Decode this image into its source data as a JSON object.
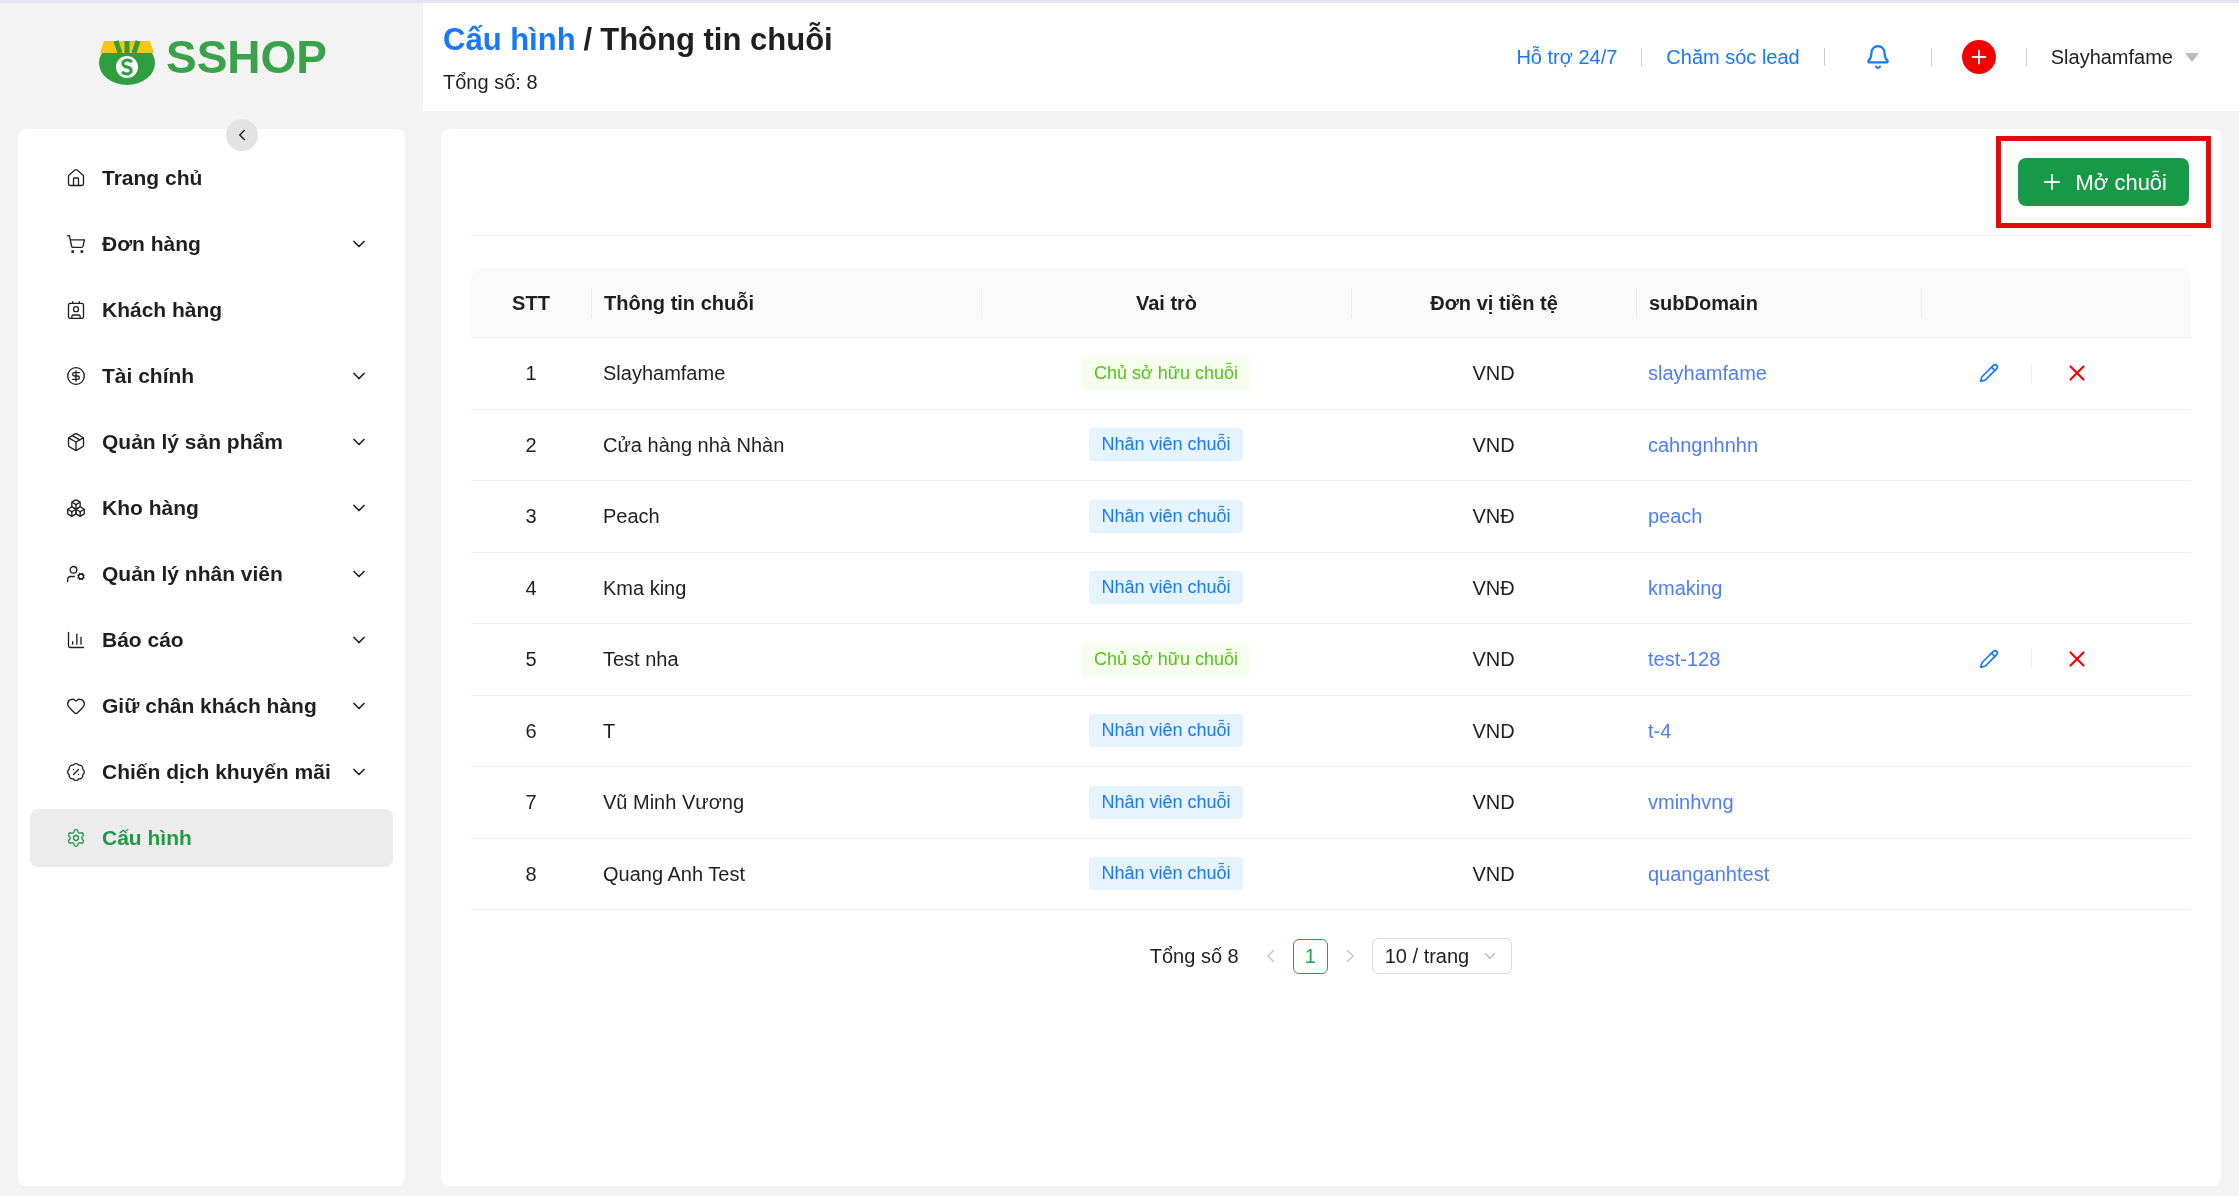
{
  "logo": {
    "text": "SSHOP"
  },
  "breadcrumb": {
    "parent": "Cấu hình",
    "separator": "/",
    "current": "Thông tin chuỗi"
  },
  "total": "Tổng số: 8",
  "header_links": [
    "Hỗ trợ 24/7",
    "Chăm sóc lead"
  ],
  "user": {
    "name": "Slayhamfame"
  },
  "sidebar": {
    "items": [
      {
        "label": "Trang chủ",
        "expandable": false,
        "selected": false
      },
      {
        "label": "Đơn hàng",
        "expandable": true,
        "selected": false
      },
      {
        "label": "Khách hàng",
        "expandable": false,
        "selected": false
      },
      {
        "label": "Tài chính",
        "expandable": true,
        "selected": false
      },
      {
        "label": "Quản lý sản phẩm",
        "expandable": true,
        "selected": false
      },
      {
        "label": "Kho hàng",
        "expandable": true,
        "selected": false
      },
      {
        "label": "Quản lý nhân viên",
        "expandable": true,
        "selected": false
      },
      {
        "label": "Báo cáo",
        "expandable": true,
        "selected": false
      },
      {
        "label": "Giữ chân khách hàng",
        "expandable": true,
        "selected": false
      },
      {
        "label": "Chiến dịch khuyến mãi",
        "expandable": true,
        "selected": false
      },
      {
        "label": "Cấu hình",
        "expandable": false,
        "selected": true
      }
    ]
  },
  "create_button": {
    "label": "Mở chuỗi",
    "highlighted": true
  },
  "table": {
    "columns": [
      "STT",
      "Thông tin chuỗi",
      "Vai trò",
      "Đơn vị tiền tệ",
      "subDomain"
    ],
    "rows": [
      {
        "stt": "1",
        "name": "Slayhamfame",
        "role": "Chủ sở hữu chuỗi",
        "kind": "owner",
        "currency": "VND",
        "subdomain": "slayhamfame",
        "editable": true
      },
      {
        "stt": "2",
        "name": "Cửa hàng nhà Nhàn",
        "role": "Nhân viên chuỗi",
        "kind": "staff",
        "currency": "VND",
        "subdomain": "cahngnhnhn",
        "editable": false
      },
      {
        "stt": "3",
        "name": "Peach",
        "role": "Nhân viên chuỗi",
        "kind": "staff",
        "currency": "VNĐ",
        "subdomain": "peach",
        "editable": false
      },
      {
        "stt": "4",
        "name": "Kma king",
        "role": "Nhân viên chuỗi",
        "kind": "staff",
        "currency": "VNĐ",
        "subdomain": "kmaking",
        "editable": false
      },
      {
        "stt": "5",
        "name": "Test nha",
        "role": "Chủ sở hữu chuỗi",
        "kind": "owner",
        "currency": "VND",
        "subdomain": "test-128",
        "editable": true
      },
      {
        "stt": "6",
        "name": "T",
        "role": "Nhân viên chuỗi",
        "kind": "staff",
        "currency": "VND",
        "subdomain": "t-4",
        "editable": false
      },
      {
        "stt": "7",
        "name": "Vũ Minh Vương",
        "role": "Nhân viên chuỗi",
        "kind": "staff",
        "currency": "VND",
        "subdomain": "vminhvng",
        "editable": false
      },
      {
        "stt": "8",
        "name": "Quang Anh Test",
        "role": "Nhân viên chuỗi",
        "kind": "staff",
        "currency": "VND",
        "subdomain": "quanganhtest",
        "editable": false
      }
    ]
  },
  "pagination": {
    "total": "Tổng số 8",
    "pages": [
      {
        "label": "1",
        "selected": true
      }
    ],
    "page_size": "10 / trang"
  }
}
